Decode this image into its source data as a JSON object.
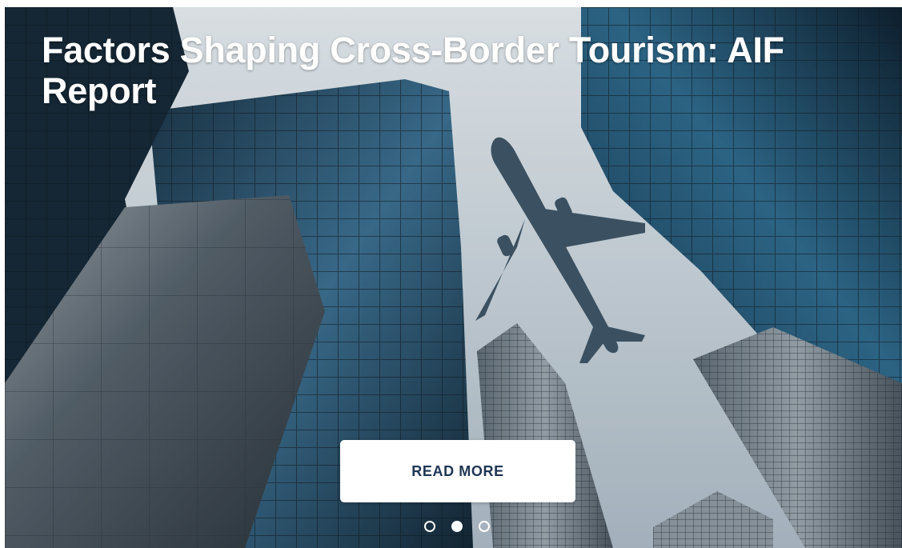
{
  "slide": {
    "headline": "Factors Shaping Cross-Border Tourism: AIF Report",
    "cta_label": "READ MORE"
  },
  "pagination": {
    "total": 3,
    "active_index": 1
  },
  "image": {
    "description_icon": "skyscrapers-airplane-photo",
    "sky_color": "#c9d4dc",
    "glass_color": "#2f5f7e",
    "shadow_color": "#12222f"
  }
}
